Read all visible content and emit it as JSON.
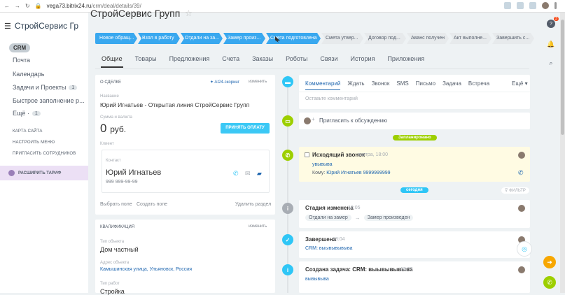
{
  "browser": {
    "url_domain": "vega73.bitrix24.ru",
    "url_path": "/crm/deal/details/39/"
  },
  "brand": {
    "name": "СтройСервис Гр"
  },
  "leftnav": {
    "crm": "CRM",
    "items": [
      {
        "label": "Почта",
        "count": ""
      },
      {
        "label": "Календарь",
        "count": ""
      },
      {
        "label": "Задачи и Проекты",
        "count": "1"
      },
      {
        "label": "Быстрое заполнение р...",
        "count": ""
      },
      {
        "label": "Ещё ·",
        "count": "1"
      }
    ],
    "links": [
      "КАРТА САЙТА",
      "НАСТРОИТЬ МЕНЮ",
      "ПРИГЛАСИТЬ СОТРУДНИКОВ"
    ],
    "tariff": "РАСШИРИТЬ ТАРИФ"
  },
  "page": {
    "title": "СтройСервис Групп"
  },
  "stages": [
    {
      "label": "Новое обращ...",
      "done": true,
      "w": 60
    },
    {
      "label": "Взял в работу",
      "done": true,
      "w": 60
    },
    {
      "label": "Отдали на за...",
      "done": true,
      "w": 60
    },
    {
      "label": "Замер произ...",
      "done": true,
      "w": 60
    },
    {
      "label": "Смета подготовлена",
      "done": true,
      "w": 78
    },
    {
      "label": "Смета утвер...",
      "done": false,
      "w": 60
    },
    {
      "label": "Договор под...",
      "done": false,
      "w": 60
    },
    {
      "label": "Аванс получен",
      "done": false,
      "w": 60
    },
    {
      "label": "Акт выполне...",
      "done": false,
      "w": 60
    },
    {
      "label": "Завершить с...",
      "done": false,
      "w": 60
    }
  ],
  "tabs": [
    "Общие",
    "Товары",
    "Предложения",
    "Счета",
    "Заказы",
    "Роботы",
    "Связи",
    "История",
    "Приложения"
  ],
  "deal": {
    "header": "О СДЕЛКЕ",
    "ai": "AI24-скоринг",
    "edit": "изменить",
    "name_label": "Название",
    "name": "Юрий Игнатьев - Открытая линия СтройСервис Групп",
    "sum_label": "Сумма и валюта",
    "sum": "0",
    "currency": "руб.",
    "pay_button": "ПРИНЯТЬ ОПЛАТУ",
    "client_label": "Клиент",
    "contact_label": "Контакт",
    "contact_name": "Юрий Игнатьев",
    "contact_phone": "999 999-99-99",
    "select_field": "Выбрать поле",
    "create_field": "Создать поле",
    "delete_section": "Удалить раздел"
  },
  "qual": {
    "header": "КВАЛИФИКАЦИЯ",
    "edit": "изменить",
    "type_label": "Тип объекта",
    "type": "Дом частный",
    "addr_label": "Адрес объекта",
    "addr": "Камышинская улица, Ульяновск, Россия",
    "work_label": "Тип работ",
    "work": "Стройка"
  },
  "activity": {
    "tabs": [
      "Комментарий",
      "Ждать",
      "Звонок",
      "SMS",
      "Письмо",
      "Задача",
      "Встреча"
    ],
    "more": "Ещё",
    "placeholder": "Оставьте комментарий",
    "invite": "Пригласить к обсуждению",
    "planned": "Запланировано",
    "call_title": "Исходящий звонок",
    "call_time": "завтра, 18:00",
    "call_note": "увывыва",
    "call_to_prefix": "Кому:",
    "call_to": "Юрий Игнатьев 9999999999",
    "today": "сегодня",
    "filter": "ФИЛЬТР",
    "stage_title": "Стадия изменена",
    "stage_time": "18:05",
    "stage_from": "Отдали на замер",
    "stage_to": "Замер произведен",
    "done_title": "Завершена",
    "done_time": "18:04",
    "done_crm": "CRM: выывывывыва",
    "task_title": "Создана задача: CRM: выывывывыва",
    "task_time": "18:03",
    "task_text": "вывывыва"
  },
  "rightbar": {
    "help_count": "3",
    "notif_count": "2"
  },
  "colors": {
    "accent": "#39a8ef",
    "green": "#9dcf00",
    "pay": "#3bc8f5"
  }
}
